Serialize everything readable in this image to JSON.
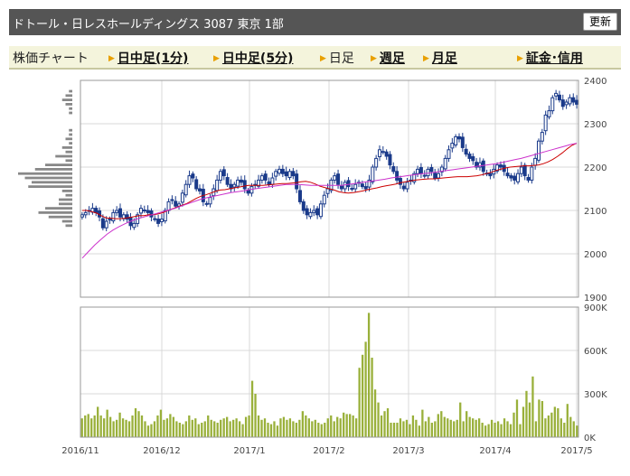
{
  "header": {
    "title": "ドトール・日レスホールディングス  3087  東京 1部",
    "refresh_label": "更新"
  },
  "nav": {
    "label": "株価チャート",
    "items": [
      {
        "label": "日中足(1分)",
        "link": true
      },
      {
        "label": "日中足(5分)",
        "link": true
      },
      {
        "label": "日足",
        "link": false
      },
      {
        "label": "週足",
        "link": true
      },
      {
        "label": "月足",
        "link": true
      },
      {
        "label": "証金･信用",
        "link": true
      }
    ]
  },
  "colors": {
    "candle": "#1a3a8a",
    "ma_short": "#cc0000",
    "ma_long": "#cc33cc",
    "volume": "#99b03a",
    "profile": "#888888",
    "grid": "#d8d8d8"
  },
  "chart_data": [
    {
      "type": "candlestick",
      "y_ticks": [
        "2400",
        "2300",
        "2200",
        "2100",
        "2000",
        "1900"
      ],
      "ylim": [
        1900,
        2400
      ],
      "x_tick_labels": [
        "2016/11",
        "2016/12",
        "2017/1",
        "2017/2",
        "2017/3",
        "2017/4",
        "2017/5"
      ],
      "closes": [
        2090,
        2095,
        2100,
        2105,
        2095,
        2085,
        2060,
        2075,
        2080,
        2095,
        2100,
        2085,
        2090,
        2080,
        2065,
        2070,
        2090,
        2105,
        2100,
        2095,
        2085,
        2080,
        2070,
        2080,
        2100,
        2120,
        2125,
        2110,
        2115,
        2140,
        2160,
        2180,
        2175,
        2150,
        2145,
        2120,
        2115,
        2130,
        2150,
        2170,
        2190,
        2180,
        2160,
        2150,
        2160,
        2170,
        2165,
        2150,
        2140,
        2155,
        2160,
        2170,
        2180,
        2170,
        2160,
        2175,
        2190,
        2195,
        2185,
        2180,
        2190,
        2180,
        2150,
        2120,
        2100,
        2090,
        2095,
        2100,
        2090,
        2115,
        2135,
        2150,
        2170,
        2180,
        2160,
        2150,
        2165,
        2155,
        2150,
        2160,
        2165,
        2155,
        2150,
        2170,
        2200,
        2220,
        2240,
        2235,
        2225,
        2205,
        2190,
        2170,
        2160,
        2150,
        2165,
        2170,
        2185,
        2195,
        2185,
        2180,
        2195,
        2190,
        2175,
        2185,
        2200,
        2220,
        2240,
        2255,
        2270,
        2265,
        2245,
        2230,
        2220,
        2215,
        2200,
        2210,
        2190,
        2185,
        2180,
        2195,
        2205,
        2200,
        2190,
        2180,
        2175,
        2170,
        2185,
        2200,
        2180,
        2170,
        2200,
        2220,
        2260,
        2280,
        2320,
        2330,
        2360,
        2370,
        2355,
        2340,
        2350,
        2360,
        2350,
        2345
      ],
      "series": [
        {
          "name": "",
          "values": [
            2100,
            2100,
            2097,
            2094,
            2088,
            2083,
            2082,
            2081,
            2081,
            2082,
            2084,
            2086,
            2088,
            2088,
            2090,
            2090,
            2092,
            2095,
            2100,
            2104,
            2108,
            2112,
            2116,
            2122,
            2128,
            2133,
            2136,
            2140,
            2144,
            2147,
            2148,
            2150,
            2152,
            2154,
            2156,
            2158,
            2158,
            2158,
            2158,
            2159,
            2160,
            2161,
            2162,
            2162,
            2163,
            2164,
            2166,
            2167,
            2165,
            2161,
            2156,
            2153,
            2150,
            2147,
            2143,
            2141,
            2140,
            2141,
            2143,
            2145,
            2148,
            2150,
            2152,
            2155,
            2157,
            2159,
            2161,
            2164,
            2166,
            2168,
            2170,
            2171,
            2172,
            2173,
            2173,
            2174,
            2175,
            2176,
            2177,
            2178,
            2178,
            2178,
            2179,
            2180,
            2182,
            2185,
            2188,
            2192,
            2195,
            2198,
            2200,
            2201,
            2202,
            2203,
            2203,
            2204,
            2205,
            2208,
            2212,
            2218,
            2225,
            2233,
            2242,
            2250,
            2255
          ]
        },
        {
          "name": "",
          "values": [
            1990,
            2005,
            2020,
            2033,
            2045,
            2055,
            2063,
            2070,
            2076,
            2081,
            2085,
            2089,
            2093,
            2097,
            2101,
            2105,
            2110,
            2115,
            2120,
            2125,
            2129,
            2132,
            2135,
            2138,
            2141,
            2143,
            2145,
            2148,
            2150,
            2152,
            2154,
            2156,
            2158,
            2160,
            2160,
            2160,
            2159,
            2158,
            2158,
            2158,
            2158,
            2158,
            2158,
            2160,
            2162,
            2164,
            2166,
            2168,
            2170,
            2172,
            2175,
            2177,
            2179,
            2181,
            2183,
            2185,
            2186,
            2188,
            2190,
            2192,
            2194,
            2196,
            2198,
            2200,
            2202,
            2204,
            2206,
            2208,
            2211,
            2214,
            2217,
            2220,
            2224,
            2228,
            2232,
            2236,
            2240,
            2244,
            2248,
            2252,
            2255
          ]
        }
      ]
    },
    {
      "type": "bar",
      "y_ticks": [
        "900K",
        "600K",
        "300K",
        "0K"
      ],
      "ylim": [
        0,
        900000
      ],
      "values": [
        130000,
        150000,
        160000,
        130000,
        150000,
        210000,
        150000,
        130000,
        190000,
        140000,
        110000,
        120000,
        170000,
        130000,
        120000,
        110000,
        150000,
        200000,
        180000,
        150000,
        110000,
        80000,
        90000,
        110000,
        150000,
        190000,
        120000,
        130000,
        160000,
        140000,
        110000,
        100000,
        90000,
        110000,
        150000,
        120000,
        130000,
        90000,
        100000,
        110000,
        150000,
        120000,
        110000,
        100000,
        120000,
        130000,
        140000,
        110000,
        120000,
        130000,
        110000,
        90000,
        140000,
        150000,
        390000,
        300000,
        150000,
        120000,
        130000,
        100000,
        90000,
        110000,
        80000,
        130000,
        140000,
        120000,
        130000,
        110000,
        100000,
        120000,
        180000,
        150000,
        130000,
        110000,
        120000,
        100000,
        90000,
        100000,
        130000,
        150000,
        110000,
        140000,
        130000,
        170000,
        160000,
        160000,
        150000,
        130000,
        480000,
        570000,
        660000,
        860000,
        550000,
        330000,
        240000,
        150000,
        180000,
        200000,
        100000,
        100000,
        100000,
        130000,
        110000,
        120000,
        90000,
        150000,
        120000,
        80000,
        190000,
        110000,
        140000,
        100000,
        110000,
        160000,
        180000,
        140000,
        130000,
        120000,
        110000,
        120000,
        240000,
        110000,
        180000,
        140000,
        130000,
        120000,
        130000,
        100000,
        80000,
        90000,
        120000,
        100000,
        110000,
        90000,
        130000,
        110000,
        90000,
        170000,
        260000,
        90000,
        210000,
        320000,
        240000,
        420000,
        110000,
        260000,
        250000,
        130000,
        150000,
        170000,
        210000,
        200000,
        130000,
        100000,
        230000,
        140000,
        110000,
        80000
      ]
    }
  ]
}
